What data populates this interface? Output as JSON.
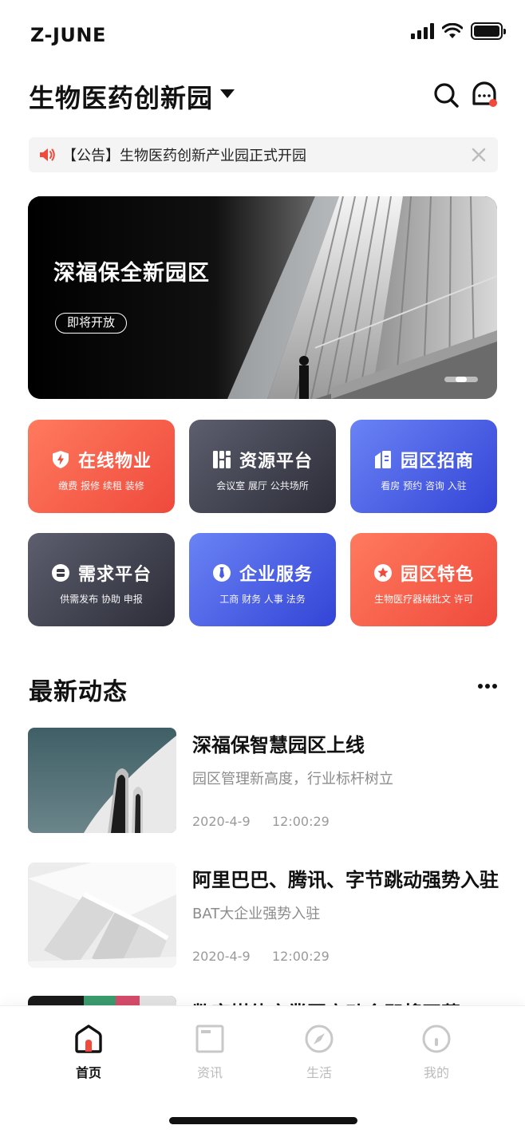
{
  "status_bar": {
    "carrier": "Z-JUNE"
  },
  "header": {
    "title": "生物医药创新园"
  },
  "notice": {
    "text": "【公告】生物医药创新产业园正式开园"
  },
  "banner": {
    "title": "深福保全新园区",
    "button": "即将开放"
  },
  "services": [
    {
      "title": "在线物业",
      "subtitle": "缴费 报修 续租 装修",
      "icon": "shield-bolt-icon"
    },
    {
      "title": "资源平台",
      "subtitle": "会议室 展厅 公共场所",
      "icon": "grid-icon"
    },
    {
      "title": "园区招商",
      "subtitle": "看房 预约 咨询 入驻",
      "icon": "building-icon"
    },
    {
      "title": "需求平台",
      "subtitle": "供需发布 协助 申报",
      "icon": "inbox-icon"
    },
    {
      "title": "企业服务",
      "subtitle": "工商 财务 人事 法务",
      "icon": "tie-icon"
    },
    {
      "title": "园区特色",
      "subtitle": "生物医疗器械批文 许可",
      "icon": "star-icon"
    }
  ],
  "news_section": {
    "title": "最新动态"
  },
  "news": [
    {
      "title": "深福保智慧园区上线",
      "subtitle": "园区管理新高度，行业标杆树立",
      "date": "2020-4-9",
      "time": "12:00:29"
    },
    {
      "title": "阿里巴巴、腾讯、字节跳动强势入驻",
      "subtitle": "BAT大企业强势入驻",
      "date": "2020-4-9",
      "time": "12:00:29"
    },
    {
      "title": "数字媒体产業园启动会即将开幕",
      "subtitle": "",
      "date": "",
      "time": ""
    }
  ],
  "tabs": [
    {
      "label": "首页",
      "icon": "home-icon",
      "active": true
    },
    {
      "label": "资讯",
      "icon": "news-icon",
      "active": false
    },
    {
      "label": "生活",
      "icon": "compass-icon",
      "active": false
    },
    {
      "label": "我的",
      "icon": "profile-icon",
      "active": false
    }
  ],
  "colors": {
    "accent_red": "#ef4a3c",
    "accent_blue": "#3344d6",
    "dark_card": "#2c2d38"
  }
}
